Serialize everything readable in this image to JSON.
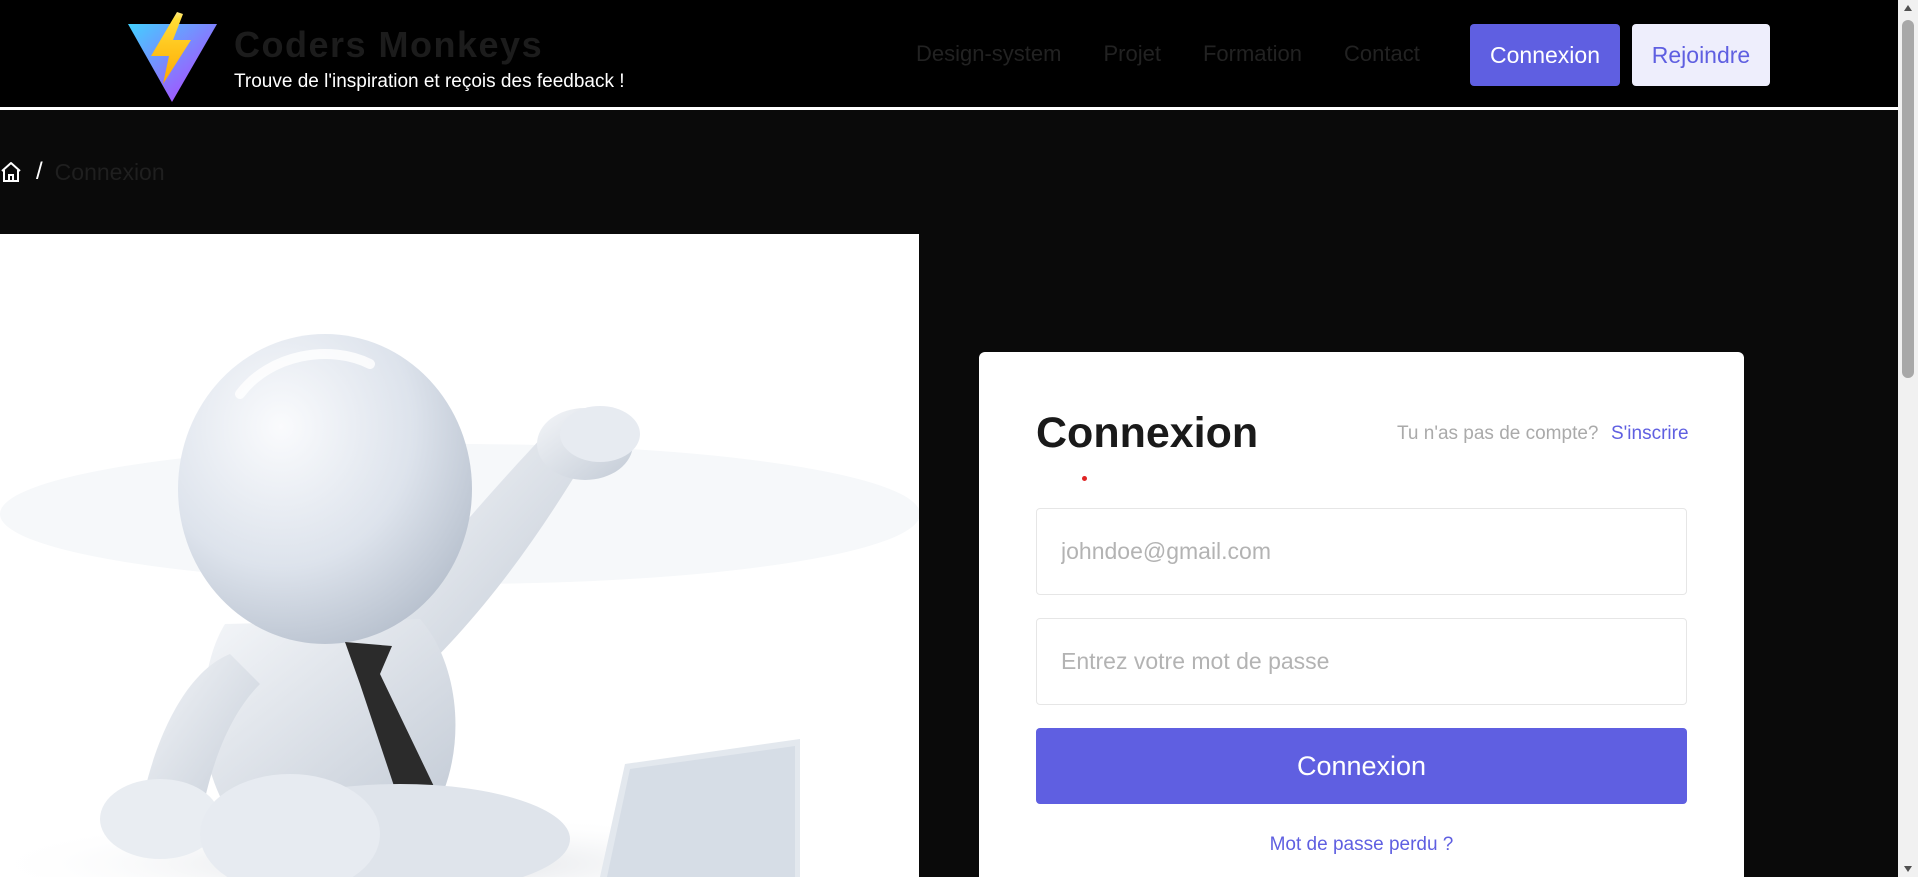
{
  "header": {
    "brand_name": "Coders Monkeys",
    "tagline": "Trouve de l'inspiration et reçois des feedback !",
    "nav": [
      "Design-system",
      "Projet",
      "Formation",
      "Contact"
    ],
    "login_label": "Connexion",
    "join_label": "Rejoindre"
  },
  "breadcrumb": {
    "separator": "/",
    "current": "Connexion"
  },
  "login": {
    "title": "Connexion",
    "no_account_prompt": "Tu n'as pas de compte?",
    "signup_link": "S'inscrire",
    "email_placeholder": "johndoe@gmail.com",
    "password_placeholder": "Entrez votre mot de passe",
    "submit_label": "Connexion",
    "forgot_password": "Mot de passe perdu ?"
  },
  "colors": {
    "accent": "#5f5fe1",
    "accent_light": "#eeeefc",
    "background": "#0a0a0a"
  },
  "icons": {
    "logo": "vite-lightning-logo",
    "home": "home-icon"
  }
}
